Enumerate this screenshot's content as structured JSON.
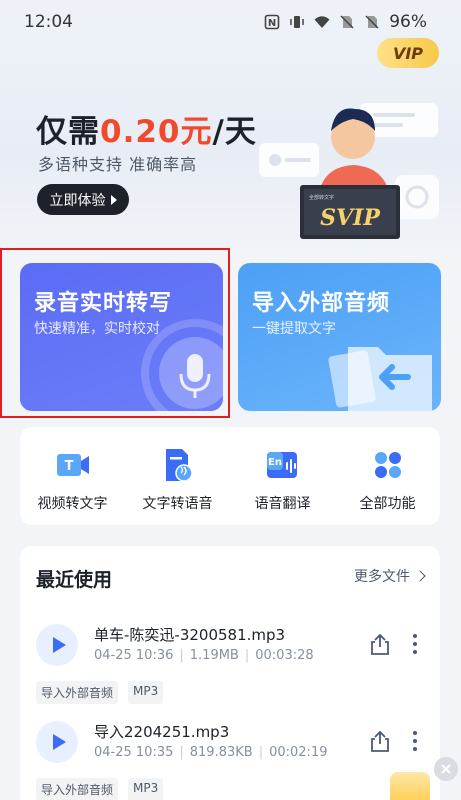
{
  "status_bar": {
    "time": "12:04",
    "battery": "96%"
  },
  "vip": {
    "label": "VIP"
  },
  "promo": {
    "title_prefix": "仅需",
    "price": "0.20元",
    "title_suffix": "/天",
    "subtitle": "多语种支持 准确率高",
    "button_label": "立即体验",
    "card_small_text": "全部转文字",
    "card_label": "SVIP"
  },
  "features": {
    "record": {
      "title": "录音实时转写",
      "subtitle": "快速精准，实时校对"
    },
    "import": {
      "title": "导入外部音频",
      "subtitle": "一键提取文字"
    }
  },
  "tools": [
    {
      "label": "视频转文字",
      "icon": "video-to-text-icon"
    },
    {
      "label": "文字转语音",
      "icon": "text-to-speech-icon"
    },
    {
      "label": "语音翻译",
      "icon": "voice-translate-icon"
    },
    {
      "label": "全部功能",
      "icon": "all-features-icon"
    }
  ],
  "recent": {
    "title": "最近使用",
    "more_label": "更多文件",
    "files": [
      {
        "name": "单车-陈奕迅-3200581.mp3",
        "date": "04-25 10:36",
        "size": "1.19MB",
        "duration": "00:03:28",
        "tags": [
          "导入外部音频",
          "MP3"
        ]
      },
      {
        "name": "导入2204251.mp3",
        "date": "04-25 10:35",
        "size": "819.83KB",
        "duration": "00:02:19",
        "tags": [
          "导入外部音频",
          "MP3"
        ]
      }
    ]
  },
  "colors": {
    "accent_blue": "#3b6cf6",
    "price_red": "#f04a2d",
    "record_card": "#5b6cf5",
    "import_card": "#4ca0f6"
  }
}
